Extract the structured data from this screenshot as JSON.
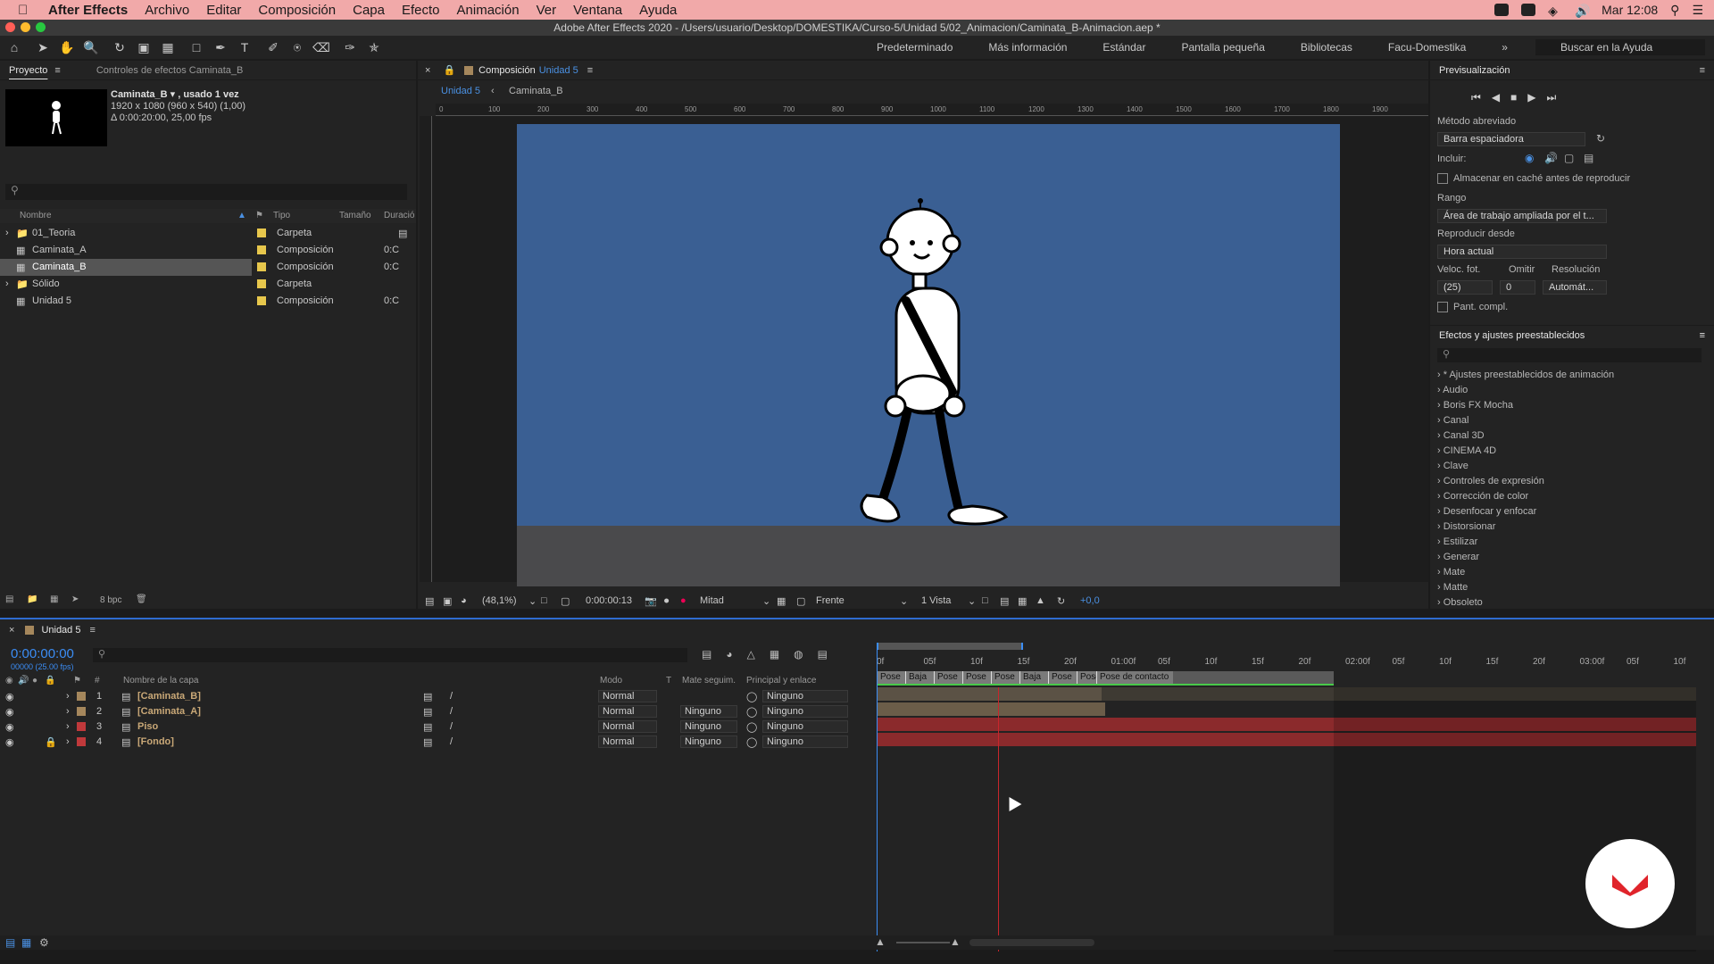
{
  "menubar": {
    "app": "After Effects",
    "items": [
      "Archivo",
      "Editar",
      "Composición",
      "Capa",
      "Efecto",
      "Animación",
      "Ver",
      "Ventana",
      "Ayuda"
    ],
    "clock": "Mar 12:08"
  },
  "window": {
    "title": "Adobe After Effects 2020 - /Users/usuario/Desktop/DOMESTIKA/Curso-5/Unidad 5/02_Animacion/Caminata_B-Animacion.aep *"
  },
  "workspaces": [
    "Predeterminado",
    "Más información",
    "Estándar",
    "Pantalla pequeña",
    "Bibliotecas",
    "Facu-Domestika"
  ],
  "help_search": "Buscar en la Ayuda",
  "project": {
    "tab": "Proyecto",
    "tab2": "Controles de efectos Caminata_B",
    "selected_name": "Caminata_B ▾ , usado 1 vez",
    "selected_size": "1920 x 1080  (960 x 540) (1,00)",
    "selected_duration": "Δ 0:00:20:00, 25,00 fps",
    "columns": [
      "Nombre",
      "Tipo",
      "Tamaño",
      "Duració"
    ],
    "items": [
      {
        "name": "01_Teoria",
        "type": "Carpeta",
        "dur": "",
        "color": "#e7c74c"
      },
      {
        "name": "Caminata_A",
        "type": "Composición",
        "dur": "0:C",
        "color": "#e7c74c"
      },
      {
        "name": "Caminata_B",
        "type": "Composición",
        "dur": "0:C",
        "color": "#e7c74c"
      },
      {
        "name": "Sólido",
        "type": "Carpeta",
        "dur": "",
        "color": "#e7c74c"
      },
      {
        "name": "Unidad 5",
        "type": "Composición",
        "dur": "0:C",
        "color": "#e7c74c"
      }
    ],
    "bpc": "8 bpc"
  },
  "comp": {
    "tab_label": "Composición",
    "tab_name": "Unidad 5",
    "breadcrumb": [
      "Unidad 5",
      "Caminata_B"
    ],
    "zoom": "(48,1%)",
    "timecode": "0:00:00:13",
    "resolution": "Mitad",
    "view": "Frente",
    "views": "1 Vista",
    "exposure": "+0,0",
    "ruler_ticks": [
      "0",
      "100",
      "200",
      "300",
      "400",
      "500",
      "600",
      "700",
      "800",
      "900",
      "1000",
      "1100",
      "1200",
      "1300",
      "1400",
      "1500",
      "1600",
      "1700",
      "1800",
      "1900"
    ],
    "bg_color": "#3a5f93",
    "floor_color": "#4a4a4c"
  },
  "preview": {
    "title": "Previsualización",
    "shortcut_label": "Método abreviado",
    "shortcut_value": "Barra espaciadora",
    "include_label": "Incluir:",
    "cache_label": "Almacenar en caché antes de reproducir",
    "range_label": "Rango",
    "range_value": "Área de trabajo ampliada por el t...",
    "play_from_label": "Reproducir desde",
    "play_from_value": "Hora actual",
    "fps_label": "Veloc. fot.",
    "skip_label": "Omitir",
    "res_label": "Resolución",
    "fps_value": "(25)",
    "skip_value": "0",
    "res_value": "Automát...",
    "fullscreen_label": "Pant. compl."
  },
  "effects": {
    "title": "Efectos y ajustes preestablecidos",
    "items": [
      "* Ajustes preestablecidos de animación",
      "Audio",
      "Boris FX Mocha",
      "Canal",
      "Canal 3D",
      "CINEMA 4D",
      "Clave",
      "Controles de expresión",
      "Corrección de color",
      "Desenfocar y enfocar",
      "Distorsionar",
      "Estilizar",
      "Generar",
      "Mate",
      "Matte",
      "Obsoleto"
    ]
  },
  "timeline": {
    "tab": "Unidad 5",
    "timecode": "0:00:00:00",
    "fps": "00000 (25.00 fps)",
    "columns": [
      "Nombre de la capa",
      "Modo",
      "T",
      "Mate seguim.",
      "Principal y enlace"
    ],
    "layers": [
      {
        "num": "1",
        "name": "[Caminata_B]",
        "mode": "Normal",
        "matte": "",
        "parent": "Ninguno",
        "color": "#a5875c"
      },
      {
        "num": "2",
        "name": "[Caminata_A]",
        "mode": "Normal",
        "matte": "Ninguno",
        "parent": "Ninguno",
        "color": "#a5875c"
      },
      {
        "num": "3",
        "name": "Piso",
        "mode": "Normal",
        "matte": "Ninguno",
        "parent": "Ninguno",
        "color": "#c0393b"
      },
      {
        "num": "4",
        "name": "[Fondo]",
        "mode": "Normal",
        "matte": "Ninguno",
        "parent": "Ninguno",
        "color": "#c0393b"
      }
    ],
    "ruler": [
      "0f",
      "05f",
      "10f",
      "15f",
      "20f",
      "01:00f",
      "05f",
      "10f",
      "15f",
      "20f",
      "02:00f",
      "05f",
      "10f",
      "15f",
      "20f",
      "03:00f",
      "05f",
      "10f"
    ],
    "markers": [
      "Pose",
      "Baja",
      "Pose",
      "Pose",
      "Pose",
      "Baja",
      "Pose",
      "Pose",
      "Pose de contacto"
    ]
  }
}
